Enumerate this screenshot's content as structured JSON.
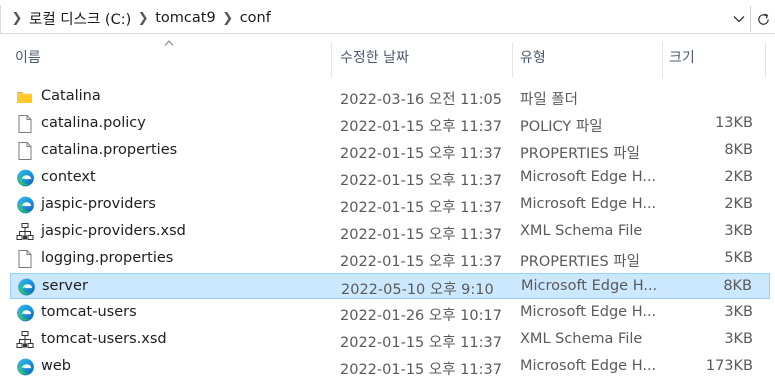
{
  "address": {
    "crumbs": [
      "로컬 디스크 (C:)",
      "tomcat9",
      "conf"
    ]
  },
  "columns": {
    "name": "이름",
    "date": "수정한 날짜",
    "type": "유형",
    "size": "크기"
  },
  "files": [
    {
      "name": "Catalina",
      "date": "2022-03-16 오전 11:05",
      "type": "파일 폴더",
      "size": "",
      "icon": "folder-icon",
      "selected": false
    },
    {
      "name": "catalina.policy",
      "date": "2022-01-15 오후 11:37",
      "type": "POLICY 파일",
      "size": "13KB",
      "icon": "file-icon",
      "selected": false
    },
    {
      "name": "catalina.properties",
      "date": "2022-01-15 오후 11:37",
      "type": "PROPERTIES 파일",
      "size": "8KB",
      "icon": "file-icon",
      "selected": false
    },
    {
      "name": "context",
      "date": "2022-01-15 오후 11:37",
      "type": "Microsoft Edge H...",
      "size": "2KB",
      "icon": "edge-icon",
      "selected": false
    },
    {
      "name": "jaspic-providers",
      "date": "2022-01-15 오후 11:37",
      "type": "Microsoft Edge H...",
      "size": "2KB",
      "icon": "edge-icon",
      "selected": false
    },
    {
      "name": "jaspic-providers.xsd",
      "date": "2022-01-15 오후 11:37",
      "type": "XML Schema File",
      "size": "3KB",
      "icon": "xml-schema-icon",
      "selected": false
    },
    {
      "name": "logging.properties",
      "date": "2022-01-15 오후 11:37",
      "type": "PROPERTIES 파일",
      "size": "5KB",
      "icon": "file-icon",
      "selected": false
    },
    {
      "name": "server",
      "date": "2022-05-10 오후 9:10",
      "type": "Microsoft Edge H...",
      "size": "8KB",
      "icon": "edge-icon",
      "selected": true
    },
    {
      "name": "tomcat-users",
      "date": "2022-01-26 오후 10:17",
      "type": "Microsoft Edge H...",
      "size": "3KB",
      "icon": "edge-icon",
      "selected": false
    },
    {
      "name": "tomcat-users.xsd",
      "date": "2022-01-15 오후 11:37",
      "type": "XML Schema File",
      "size": "3KB",
      "icon": "xml-schema-icon",
      "selected": false
    },
    {
      "name": "web",
      "date": "2022-01-15 오후 11:37",
      "type": "Microsoft Edge H...",
      "size": "173KB",
      "icon": "edge-icon",
      "selected": false
    }
  ]
}
